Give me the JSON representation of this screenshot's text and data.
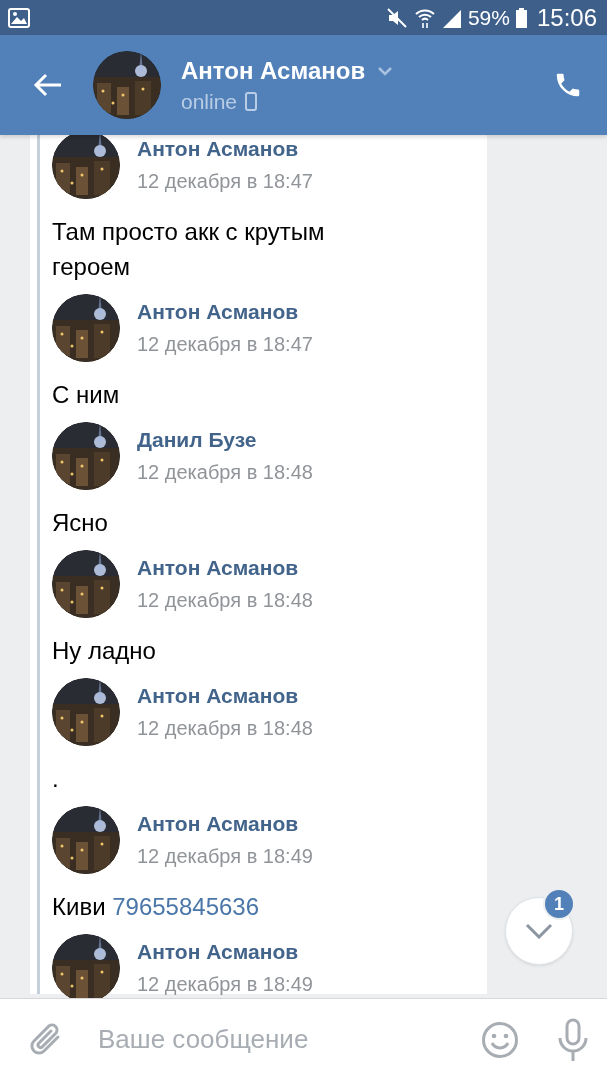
{
  "status_bar": {
    "time": "15:06",
    "battery": "59%"
  },
  "header": {
    "title": "Антон Асманов",
    "status": "online"
  },
  "messages": [
    {
      "author": "Антон Асманов",
      "time": "12 декабря в 18:47",
      "text": "Там просто акк с крутым героем"
    },
    {
      "author": "Антон Асманов",
      "time": "12 декабря в 18:47",
      "text": "С ним"
    },
    {
      "author": "Данил Бузе",
      "time": "12 декабря в 18:48",
      "text": "Ясно"
    },
    {
      "author": "Антон Асманов",
      "time": "12 декабря в 18:48",
      "text": "Ну ладно"
    },
    {
      "author": "Антон Асманов",
      "time": "12 декабря в 18:48",
      "text": "."
    },
    {
      "author": "Антон Асманов",
      "time": "12 декабря в 18:49",
      "text": "Киви",
      "link": "79655845636"
    },
    {
      "author": "Антон Асманов",
      "time": "12 декабря в 18:49"
    }
  ],
  "scroll_button": {
    "badge": "1"
  },
  "composer": {
    "placeholder": "Ваше сообщение"
  }
}
